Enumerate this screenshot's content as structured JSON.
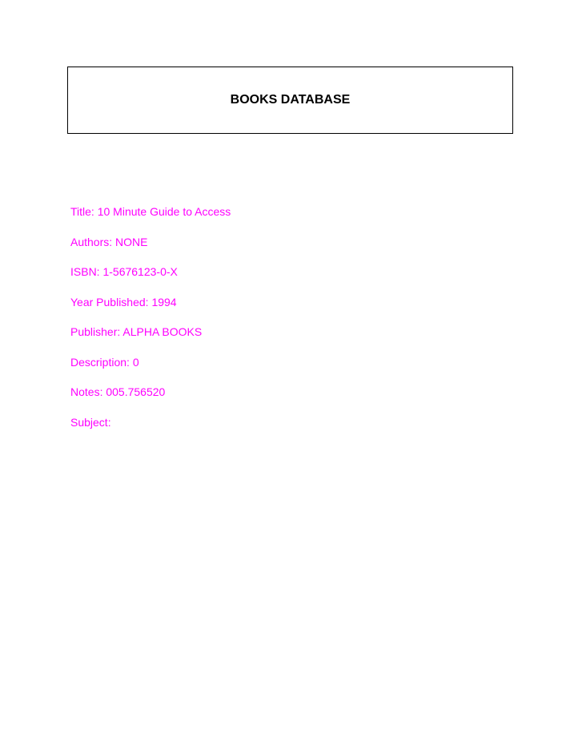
{
  "header": {
    "title": "BOOKS DATABASE"
  },
  "colors": {
    "field_text": "#ff00ff",
    "header_text": "#000000",
    "border": "#000000"
  },
  "record": {
    "fields": [
      {
        "label": "Title:",
        "value": "10 Minute Guide to Access"
      },
      {
        "label": "Authors:",
        "value": "NONE"
      },
      {
        "label": "ISBN:",
        "value": "1-5676123-0-X"
      },
      {
        "label": "Year Published:",
        "value": "1994"
      },
      {
        "label": "Publisher:",
        "value": "ALPHA BOOKS"
      },
      {
        "label": "Description:",
        "value": "0"
      },
      {
        "label": "Notes:",
        "value": "005.756520"
      },
      {
        "label": "Subject:",
        "value": ""
      }
    ]
  }
}
